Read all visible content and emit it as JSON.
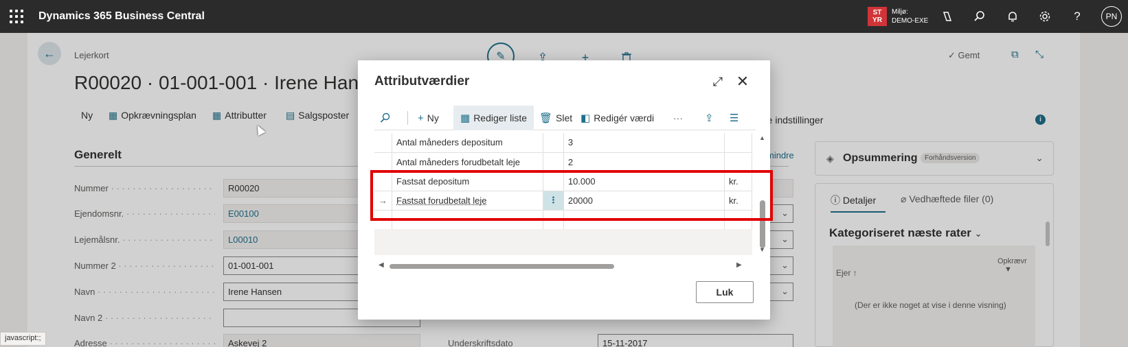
{
  "app": {
    "title": "Dynamics 365 Business Central"
  },
  "topbar": {
    "env_badge_line1": "ST",
    "env_badge_line2": "YR",
    "env_label": "Miljø:",
    "env_value": "DEMO-EXE",
    "avatar_initials": "PN",
    "icons": [
      "copilot-icon",
      "search-icon",
      "bell-icon",
      "gear-icon",
      "help-icon"
    ]
  },
  "page": {
    "breadcrumb": "Lejerkort",
    "title": "R00020 · 01-001-001 · Irene Hansen",
    "saved_label": "Gemt",
    "actions": [
      {
        "label": "Ny",
        "icon": ""
      },
      {
        "label": "Opkrævningsplan",
        "icon": "table-icon"
      },
      {
        "label": "Attributter",
        "icon": "grid-icon"
      },
      {
        "label": "Salgsposter",
        "icon": "ledger-icon"
      }
    ],
    "more_settings": "re indstillinger",
    "section_title": "Generelt",
    "show_less": "mindre",
    "fields": [
      {
        "label": "Nummer",
        "value": "R00020",
        "style": "ro"
      },
      {
        "label": "Ejendomsnr.",
        "value": "E00100",
        "style": "ro link"
      },
      {
        "label": "Lejemålsnr.",
        "value": "L00010",
        "style": "ro link"
      },
      {
        "label": "Nummer 2",
        "value": "01-001-001",
        "style": ""
      },
      {
        "label": "Navn",
        "value": "Irene Hansen",
        "style": ""
      },
      {
        "label": "Navn 2",
        "value": "",
        "style": ""
      },
      {
        "label": "Adresse",
        "value": "Askevej 2",
        "style": "ro"
      }
    ],
    "right_field_label": "Underskriftsdato",
    "right_field_value": "15-11-2017"
  },
  "factbox": {
    "summary_title": "Opsummering",
    "summary_badge": "Forhåndsversion",
    "tab_details": "Detaljer",
    "tab_attachments": "Vedhæftede filer (0)",
    "category_title": "Kategoriseret næste rater",
    "col_owner": "Ejer",
    "col_opk": "Opkrævr",
    "empty_text": "(Der er ikke noget at vise i denne visning)"
  },
  "status_bar": "javascript:;",
  "dialog": {
    "title": "Attributværdier",
    "toolbar": {
      "new": "Ny",
      "edit_list": "Rediger liste",
      "delete": "Slet",
      "edit_value": "Redigér værdi",
      "more": "···"
    },
    "rows": [
      {
        "arrow": "",
        "attribute": "Antal måneders depositum",
        "value": "3",
        "unit": ""
      },
      {
        "arrow": "",
        "attribute": "Antal måneders forudbetalt leje",
        "value": "2",
        "unit": ""
      },
      {
        "arrow": "",
        "attribute": "Fastsat depositum",
        "value": "10.000",
        "unit": "kr."
      },
      {
        "arrow": "→",
        "attribute": "Fastsat forudbetalt leje",
        "value": "20000",
        "unit": "kr.",
        "selected": true
      },
      {
        "arrow": "",
        "attribute": "",
        "value": "",
        "unit": ""
      }
    ],
    "close_label": "Luk"
  }
}
